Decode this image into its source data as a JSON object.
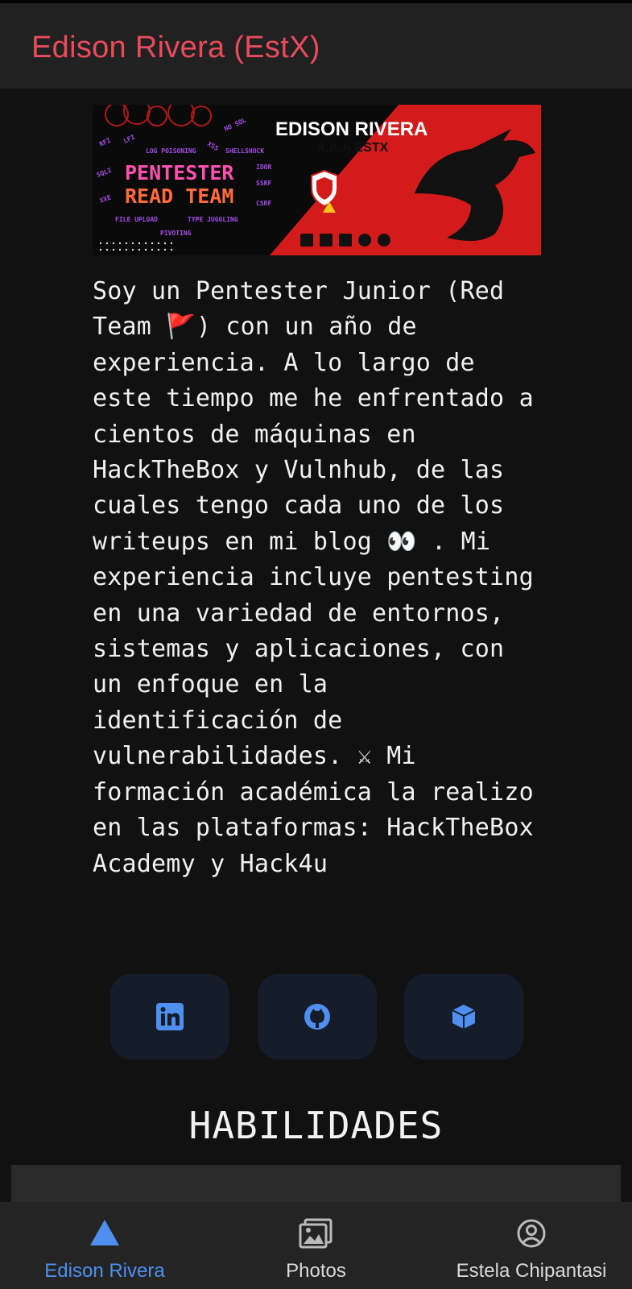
{
  "app": {
    "title": "Edison Rivera (EstX)"
  },
  "banner": {
    "name": "EDISON RIVERA",
    "aka": "A.K.A  ESTX",
    "role_line1": "PENTESTER",
    "role_line2": "READ TEAM",
    "tags": [
      "RFI",
      "LFI",
      "LOG POISONING",
      "XSS",
      "NO SQL",
      "SQLI",
      "SHELLSHOCK",
      "IDOR",
      "SSRF",
      "XXE",
      "CSRF",
      "FILE UPLOAD",
      "TYPE JUGGLING",
      "PIVOTING"
    ],
    "icons": [
      "hackthebox-icon",
      "linkedin-icon",
      "tryhackme-icon",
      "gitlab-icon",
      "github-icon"
    ]
  },
  "bio": {
    "text": "Soy un Pentester Junior (Red Team 🚩) con un año de experiencia. A lo largo de este tiempo me he enfrentado a cientos de máquinas en HackTheBox y Vulnhub, de las cuales tengo cada uno de los writeups en mi blog 👀 . Mi experiencia incluye pentesting en una variedad de entornos, sistemas y aplicaciones, con un enfoque en la identificación de vulnerabilidades. ⚔ Mi formación académica la realizo en las plataformas: HackTheBox Academy y Hack4u"
  },
  "social": [
    {
      "name": "linkedin",
      "icon": "linkedin-icon"
    },
    {
      "name": "github",
      "icon": "github-icon"
    },
    {
      "name": "hackthebox",
      "icon": "hackthebox-icon"
    }
  ],
  "skills": {
    "title": "HABILIDADES"
  },
  "nav": {
    "items": [
      {
        "label": "Edison Rivera",
        "icon": "triangle-icon",
        "active": true
      },
      {
        "label": "Photos",
        "icon": "photos-icon",
        "active": false
      },
      {
        "label": "Estela Chipantasi",
        "icon": "account-icon",
        "active": false
      }
    ]
  },
  "colors": {
    "accent_red": "#e94b5b",
    "accent_blue": "#4e8ff0",
    "background": "#111111",
    "appbar": "#212121",
    "banner_red": "#d31b1b"
  }
}
